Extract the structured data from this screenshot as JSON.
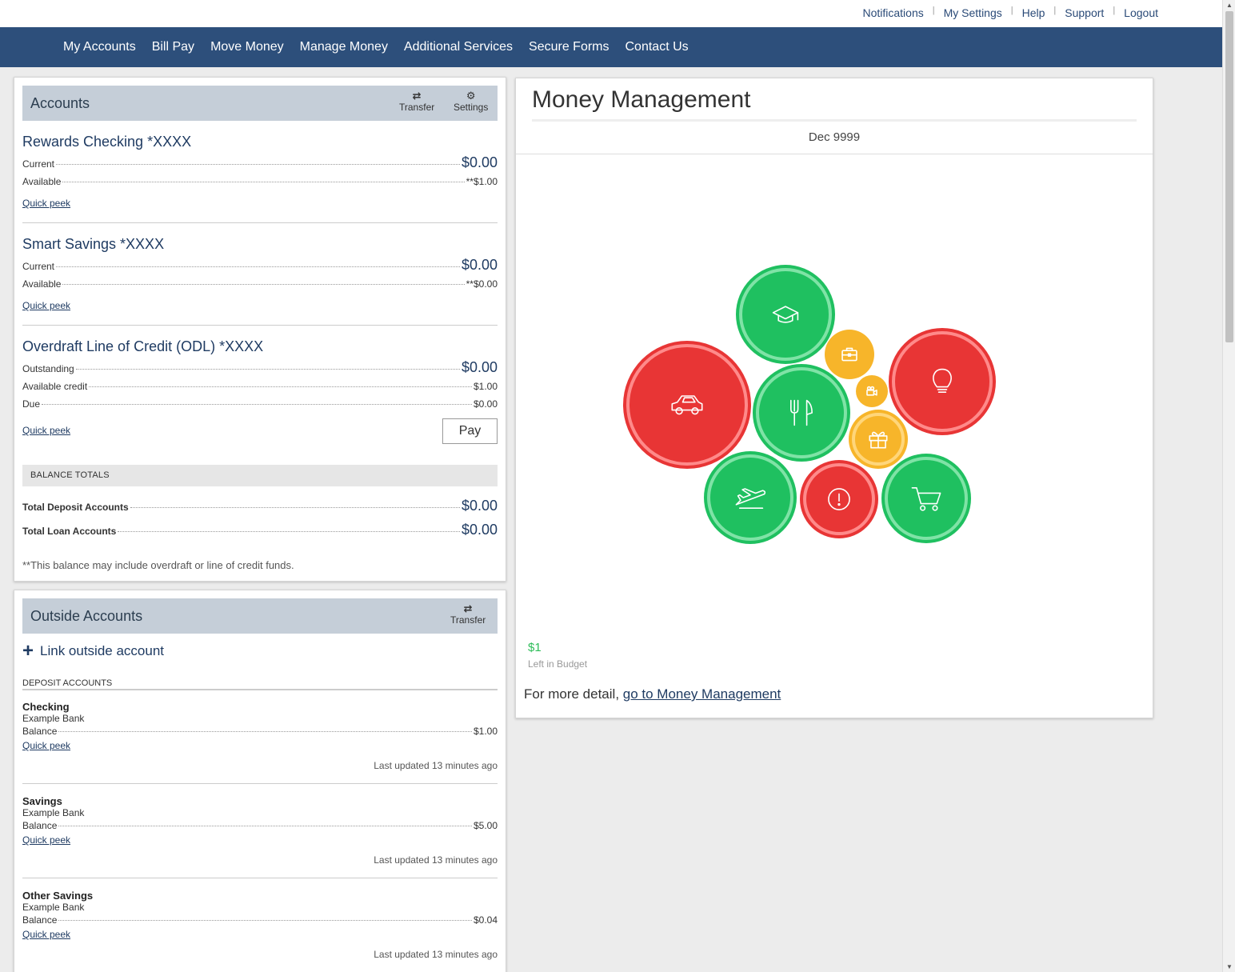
{
  "top_links": [
    "Notifications",
    "My Settings",
    "Help",
    "Support",
    "Logout"
  ],
  "nav": [
    "My Accounts",
    "Bill Pay",
    "Move Money",
    "Manage Money",
    "Additional Services",
    "Secure Forms",
    "Contact Us"
  ],
  "accounts_panel": {
    "title": "Accounts",
    "transfer_label": "Transfer",
    "settings_label": "Settings",
    "transfer_icon": "transfer-arrows-icon",
    "settings_icon": "gear-icon",
    "accounts": [
      {
        "name": "Rewards Checking  *XXXX",
        "rows": [
          {
            "label": "Current",
            "value": "$0.00"
          },
          {
            "label": "Available",
            "value": "**$1.00"
          }
        ],
        "quick_peek": "Quick peek"
      },
      {
        "name": "Smart Savings  *XXXX",
        "rows": [
          {
            "label": "Current",
            "value": "$0.00"
          },
          {
            "label": "Available",
            "value": "**$0.00"
          }
        ],
        "quick_peek": "Quick peek"
      },
      {
        "name": "Overdraft Line of Credit (ODL)  *XXXX",
        "rows": [
          {
            "label": "Outstanding",
            "value": "$0.00"
          },
          {
            "label": "Available credit",
            "value": "$1.00"
          },
          {
            "label": "Due",
            "value": "$0.00"
          }
        ],
        "quick_peek": "Quick peek",
        "pay_label": "Pay"
      }
    ],
    "totals_header": "BALANCE TOTALS",
    "totals": [
      {
        "label": "Total Deposit Accounts",
        "value": "$0.00"
      },
      {
        "label": "Total Loan Accounts",
        "value": "$0.00"
      }
    ],
    "note": "**This balance may include overdraft or line of credit funds."
  },
  "outside_panel": {
    "title": "Outside Accounts",
    "transfer_label": "Transfer",
    "link_label": "Link outside account",
    "deposit_header": "DEPOSIT ACCOUNTS",
    "accounts": [
      {
        "name": "Checking",
        "bank": "Example Bank",
        "balance_label": "Balance",
        "balance": "$1.00",
        "quick_peek": "Quick peek",
        "updated": "Last updated 13 minutes ago"
      },
      {
        "name": "Savings",
        "bank": "Example Bank",
        "balance_label": "Balance",
        "balance": "$5.00",
        "quick_peek": "Quick peek",
        "updated": "Last updated 13 minutes ago"
      },
      {
        "name": "Other Savings",
        "bank": "Example Bank",
        "balance_label": "Balance",
        "balance": "$0.04",
        "quick_peek": "Quick peek",
        "updated": "Last updated 13 minutes ago"
      }
    ]
  },
  "money_management": {
    "title": "Money Management",
    "month": "Dec 9999",
    "left_amount": "$1",
    "left_label": "Left in Budget",
    "detail_prefix": "For more detail, ",
    "detail_link": "go to Money Management",
    "colors": {
      "green": "#1fc060",
      "red": "#e83535",
      "yellow": "#f7b52a"
    },
    "bubbles": [
      {
        "icon": "graduation-cap-icon",
        "status": "green"
      },
      {
        "icon": "briefcase-icon",
        "status": "yellow"
      },
      {
        "icon": "lightbulb-icon",
        "status": "red"
      },
      {
        "icon": "car-icon",
        "status": "red"
      },
      {
        "icon": "fork-knife-icon",
        "status": "green"
      },
      {
        "icon": "video-camera-icon",
        "status": "yellow"
      },
      {
        "icon": "gift-icon",
        "status": "yellow"
      },
      {
        "icon": "airplane-icon",
        "status": "green"
      },
      {
        "icon": "alert-icon",
        "status": "red"
      },
      {
        "icon": "shopping-cart-icon",
        "status": "green"
      }
    ]
  }
}
